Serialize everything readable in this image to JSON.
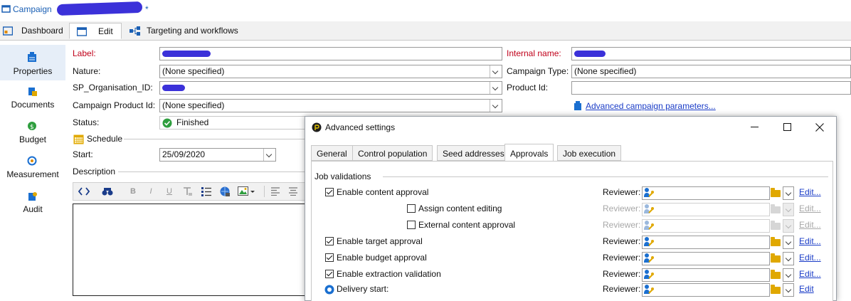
{
  "window": {
    "title": "Campaign",
    "modified_marker": "*"
  },
  "tabs": [
    {
      "label": "Dashboard",
      "icon": "dashboard-icon"
    },
    {
      "label": "Edit",
      "icon": "edit-form-icon"
    },
    {
      "label": "Targeting and workflows",
      "icon": "workflow-icon"
    }
  ],
  "sidebar": {
    "items": [
      {
        "label": "Properties",
        "icon": "properties-icon",
        "selected": true
      },
      {
        "label": "Documents",
        "icon": "documents-icon"
      },
      {
        "label": "Budget",
        "icon": "budget-icon"
      },
      {
        "label": "Measurement",
        "icon": "measurement-icon"
      },
      {
        "label": "Audit",
        "icon": "audit-icon"
      }
    ]
  },
  "form": {
    "label_label": "Label:",
    "nature_label": "Nature:",
    "nature_value": "(None specified)",
    "org_label": "SP_Organisation_ID:",
    "campaign_product_label": "Campaign Product Id:",
    "campaign_product_value": "(None specified)",
    "status_label": "Status:",
    "status_value": "Finished",
    "internal_name_label": "Internal name:",
    "campaign_type_label": "Campaign Type:",
    "campaign_type_value": "(None specified)",
    "product_id_label": "Product Id:",
    "advanced_link": "Advanced campaign parameters...",
    "schedule_section": "Schedule",
    "start_label": "Start:",
    "start_value": "25/09/2020",
    "description_section": "Description"
  },
  "editor_toolbar": [
    "B",
    "I",
    "U"
  ],
  "dialog": {
    "title": "Advanced settings",
    "tabs": [
      "General",
      "Control population",
      "Seed addresses",
      "Approvals",
      "Job execution"
    ],
    "active_tab": "Approvals",
    "section": "Job validations",
    "rows": [
      {
        "label": "Enable content approval",
        "checked": true,
        "enabled": true,
        "reviewer": "Reviewer:",
        "edit": "Edit..."
      },
      {
        "label": "Assign content editing",
        "checked": false,
        "enabled": false,
        "reviewer": "Reviewer:",
        "edit": "Edit..."
      },
      {
        "label": "External content approval",
        "checked": false,
        "enabled": false,
        "reviewer": "Reviewer:",
        "edit": "Edit..."
      },
      {
        "label": "Enable target approval",
        "checked": true,
        "enabled": true,
        "reviewer": "Reviewer:",
        "edit": "Edit..."
      },
      {
        "label": "Enable budget approval",
        "checked": true,
        "enabled": true,
        "reviewer": "Reviewer:",
        "edit": "Edit..."
      },
      {
        "label": "Enable extraction validation",
        "checked": true,
        "enabled": true,
        "reviewer": "Reviewer:",
        "edit": "Edit..."
      },
      {
        "label": "Delivery start:",
        "checked": null,
        "enabled": true,
        "reviewer": "Reviewer:",
        "edit": "Edit"
      }
    ]
  },
  "colors": {
    "required_label": "#c0001a",
    "link": "#1a3cc7",
    "folder": "#e0a800",
    "status_ok": "#2e9e3e"
  }
}
